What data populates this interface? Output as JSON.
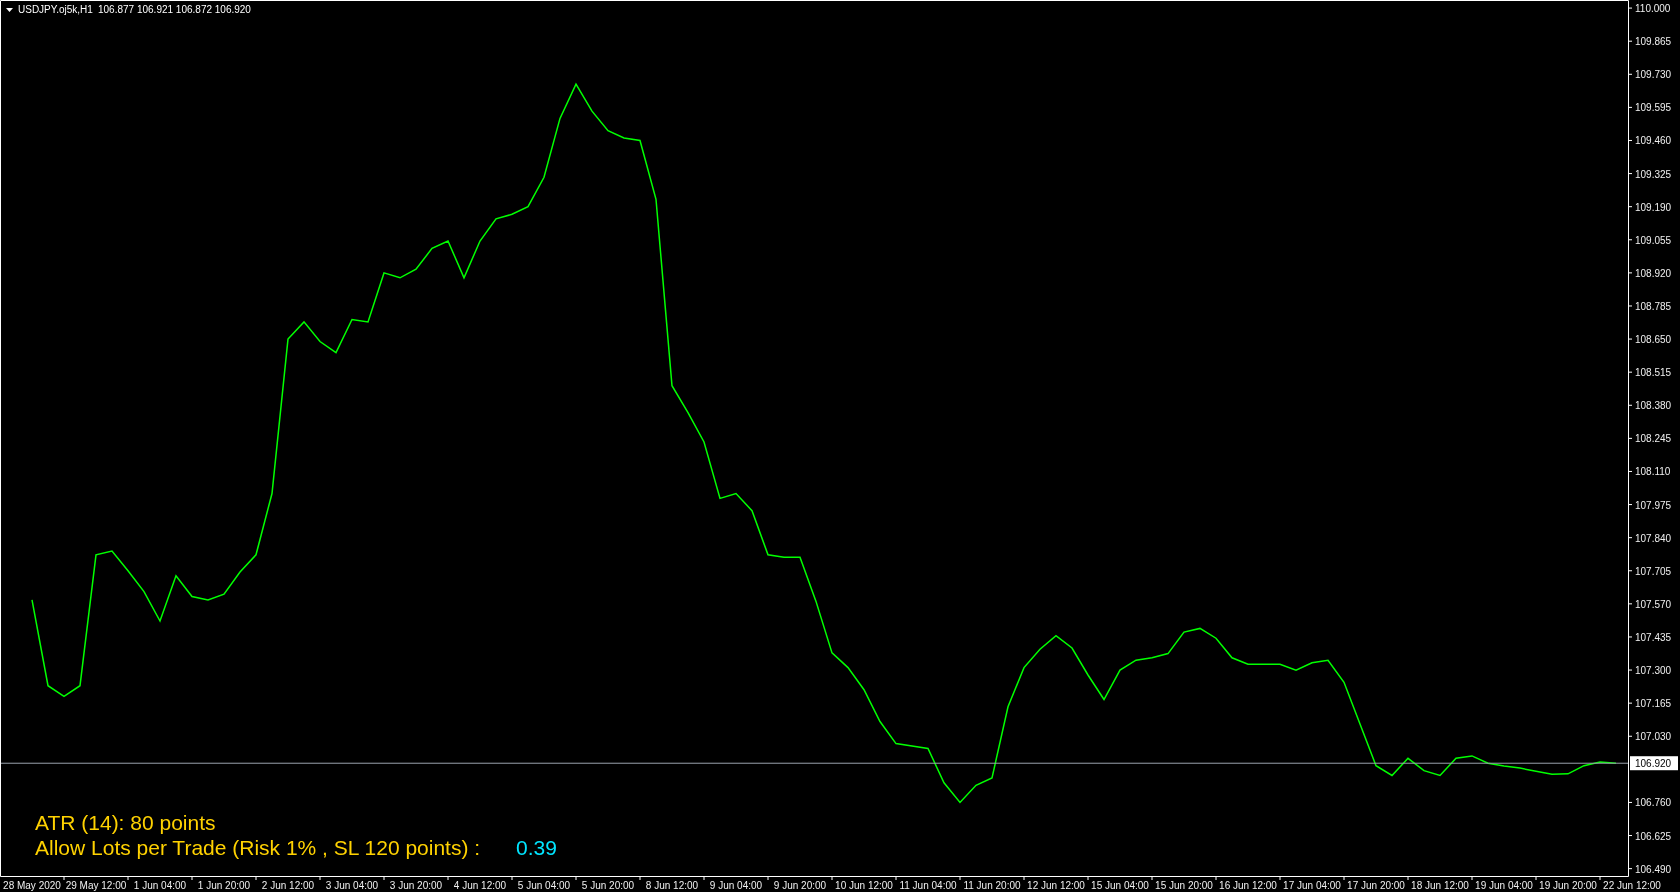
{
  "chart": {
    "quote": "106.877 106.921 106.872 106.920",
    "chart_data": {
      "type": "line",
      "title": "USDJPY.oj5k,H1",
      "categories": [
        "28 May 2020",
        null,
        null,
        null,
        "29 May 12:00",
        null,
        null,
        null,
        "1 Jun 04:00",
        null,
        null,
        null,
        "1 Jun 20:00",
        null,
        null,
        null,
        "2 Jun 12:00",
        null,
        null,
        null,
        "3 Jun 04:00",
        null,
        null,
        null,
        "3 Jun 20:00",
        null,
        null,
        null,
        "4 Jun 12:00",
        null,
        null,
        null,
        "5 Jun 04:00",
        null,
        null,
        null,
        "5 Jun 20:00",
        null,
        null,
        null,
        "8 Jun 12:00",
        null,
        null,
        null,
        "9 Jun 04:00",
        null,
        null,
        null,
        "9 Jun 20:00",
        null,
        null,
        null,
        "10 Jun 12:00",
        null,
        null,
        null,
        "11 Jun 04:00",
        null,
        null,
        null,
        "11 Jun 20:00",
        null,
        null,
        null,
        "12 Jun 12:00",
        null,
        null,
        null,
        "15 Jun 04:00",
        null,
        null,
        null,
        "15 Jun 20:00",
        null,
        null,
        null,
        "16 Jun 12:00",
        null,
        null,
        null,
        "17 Jun 04:00",
        null,
        null,
        null,
        "17 Jun 20:00",
        null,
        null,
        null,
        "18 Jun 12:00",
        null,
        null,
        null,
        "19 Jun 04:00",
        null,
        null,
        null,
        "19 Jun 20:00",
        null,
        null,
        null,
        "22 Jun 12:00"
      ],
      "series": [
        {
          "color": "#00ff00",
          "values": [
            107.586,
            107.236,
            107.193,
            107.236,
            107.77,
            107.785,
            107.705,
            107.62,
            107.5,
            107.685,
            107.6,
            107.586,
            107.61,
            107.7,
            107.77,
            108.02,
            108.65,
            108.72,
            108.64,
            108.595,
            108.73,
            108.72,
            108.92,
            108.9,
            108.935,
            109.02,
            109.05,
            108.9,
            109.05,
            109.14,
            109.159,
            109.19,
            109.31,
            109.55,
            109.69,
            109.58,
            109.5,
            109.47,
            109.46,
            109.22,
            108.46,
            108.35,
            108.23,
            108.0,
            108.02,
            107.95,
            107.77,
            107.76,
            107.76,
            107.58,
            107.37,
            107.31,
            107.22,
            107.09,
            107.0,
            106.99,
            106.98,
            106.84,
            106.76,
            106.83,
            106.86,
            107.15,
            107.31,
            107.385,
            107.44,
            107.39,
            107.28,
            107.18,
            107.3,
            107.34,
            107.35,
            107.367,
            107.455,
            107.47,
            107.43,
            107.35,
            107.324,
            107.324,
            107.324,
            107.3,
            107.33,
            107.34,
            107.25,
            107.08,
            106.91,
            106.87,
            106.94,
            106.89,
            106.87,
            106.94,
            106.95,
            106.92,
            106.909,
            106.9,
            106.887,
            106.875,
            106.877,
            106.91,
            106.925,
            106.92,
            null
          ]
        }
      ],
      "ylim": [
        106.46,
        110.033
      ],
      "yticks": [
        {
          "value": 110.0,
          "label": "110.000"
        },
        {
          "value": 109.865,
          "label": "109.865"
        },
        {
          "value": 109.73,
          "label": "109.730"
        },
        {
          "value": 109.595,
          "label": "109.595"
        },
        {
          "value": 109.46,
          "label": "109.460"
        },
        {
          "value": 109.325,
          "label": "109.325"
        },
        {
          "value": 109.19,
          "label": "109.190"
        },
        {
          "value": 109.055,
          "label": "109.055"
        },
        {
          "value": 108.92,
          "label": "108.920"
        },
        {
          "value": 108.785,
          "label": "108.785"
        },
        {
          "value": 108.65,
          "label": "108.650"
        },
        {
          "value": 108.515,
          "label": "108.515"
        },
        {
          "value": 108.38,
          "label": "108.380"
        },
        {
          "value": 108.245,
          "label": "108.245"
        },
        {
          "value": 108.11,
          "label": "108.110"
        },
        {
          "value": 107.975,
          "label": "107.975"
        },
        {
          "value": 107.84,
          "label": "107.840"
        },
        {
          "value": 107.705,
          "label": "107.705"
        },
        {
          "value": 107.57,
          "label": "107.570"
        },
        {
          "value": 107.435,
          "label": "107.435"
        },
        {
          "value": 107.3,
          "label": "107.300"
        },
        {
          "value": 107.165,
          "label": "107.165"
        },
        {
          "value": 107.03,
          "label": "107.030"
        },
        {
          "value": 106.76,
          "label": "106.760"
        },
        {
          "value": 106.625,
          "label": "106.625"
        },
        {
          "value": 106.49,
          "label": "106.490"
        }
      ],
      "ref_lines": [
        {
          "axis": "y",
          "value": 106.92,
          "label": "106.920",
          "color": "#9aa3ad"
        }
      ]
    }
  },
  "info": {
    "atr": "ATR (14): 80 points",
    "lots_label": "Allow Lots per Trade (Risk 1% , SL 120 points) :",
    "lots_value": "0.39"
  }
}
